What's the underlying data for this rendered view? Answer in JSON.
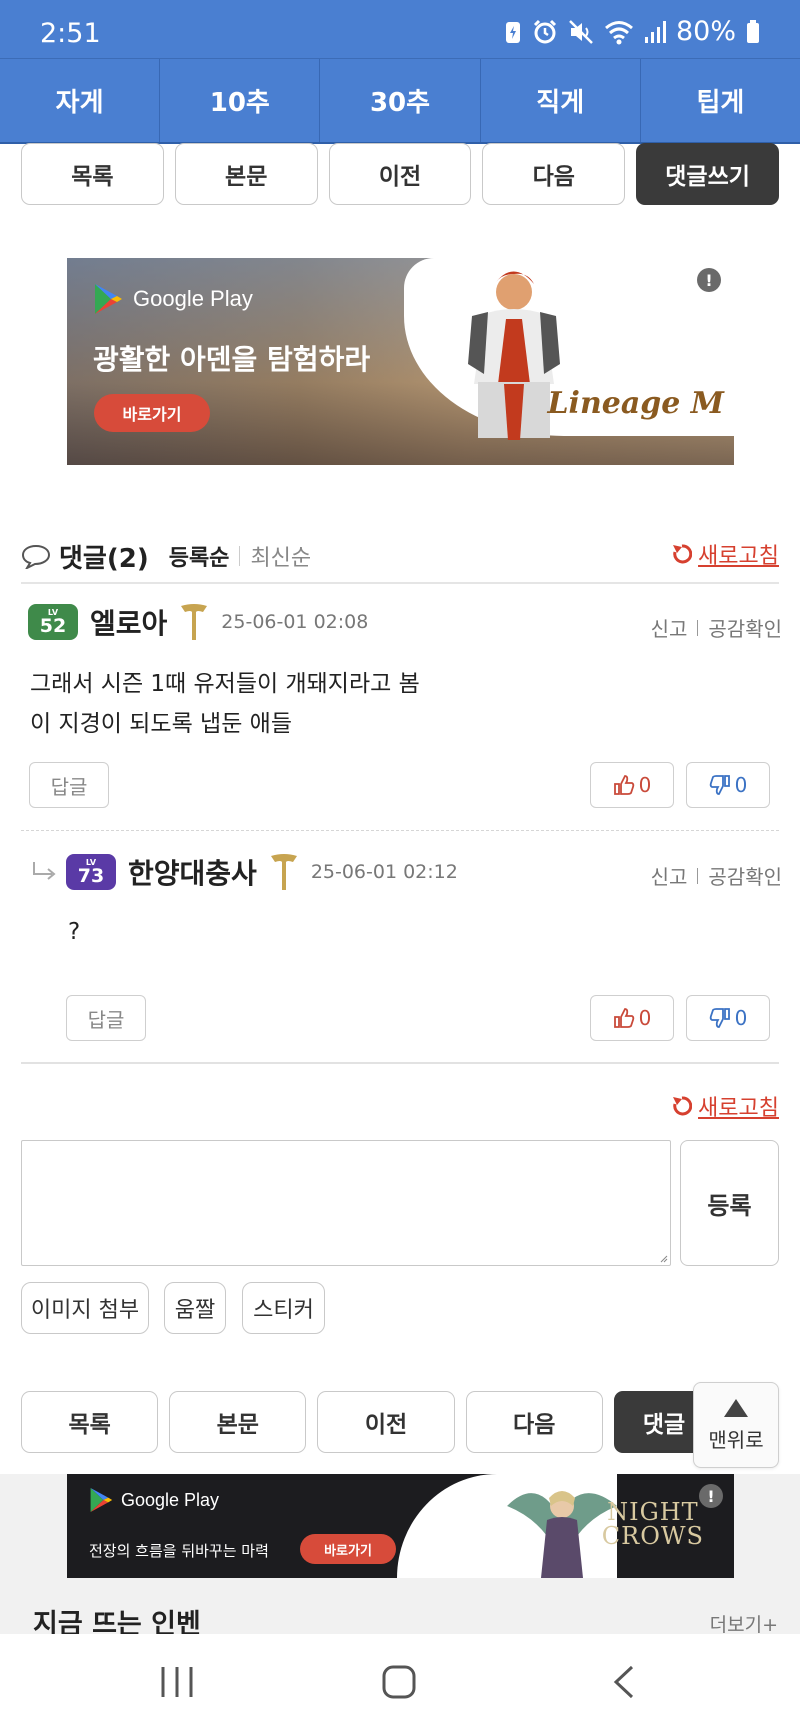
{
  "status_bar": {
    "time": "2:51",
    "battery": "80%"
  },
  "category_nav": [
    "자게",
    "10추",
    "30추",
    "직게",
    "팁게"
  ],
  "post_nav": {
    "list": "목록",
    "body": "본문",
    "prev": "이전",
    "next": "다음",
    "write_comment": "댓글쓰기",
    "write_comment_partial": "댓글"
  },
  "ad_top": {
    "store": "Google Play",
    "headline": "광활한 아덴을 탐험하라",
    "cta": "바로가기",
    "logo": "Lineage M",
    "info": "!"
  },
  "comments": {
    "title": "댓글",
    "count": "(2)",
    "sort_oldest": "등록순",
    "sort_newest": "최신순",
    "refresh": "새로고침",
    "items": [
      {
        "level_label": "LV",
        "level": "52",
        "nickname": "엘로아",
        "date": "25-06-01 02:08",
        "report": "신고",
        "likes_check": "공감확인",
        "text_line1": "그래서 시즌 1때 유저들이 개돼지라고 봄",
        "text_line2": "이 지경이 되도록 냅둔 애들",
        "reply": "답글",
        "up": "0",
        "down": "0"
      },
      {
        "level_label": "LV",
        "level": "73",
        "nickname": "한양대충사",
        "date": "25-06-01 02:12",
        "report": "신고",
        "likes_check": "공감확인",
        "text": "?",
        "reply": "답글",
        "up": "0",
        "down": "0"
      }
    ]
  },
  "write": {
    "refresh": "새로고침",
    "submit": "등록",
    "attach_image": "이미지 첨부",
    "gif": "움짤",
    "sticker": "스티커"
  },
  "go_top": "맨위로",
  "ad_bottom": {
    "store": "Google Play",
    "subtitle": "전장의 흐름을 뒤바꾸는 마력",
    "cta": "바로가기",
    "logo_line1": "NIGHT",
    "logo_line2": "CROWS",
    "info": "!"
  },
  "trending": {
    "title": "지금 뜨는 인벤",
    "more": "더보기+"
  },
  "colors": {
    "header_blue": "#4a7fd1",
    "accent_red": "#d6402f",
    "level52": "#3f8a4a",
    "level73": "#5a3aa6"
  }
}
